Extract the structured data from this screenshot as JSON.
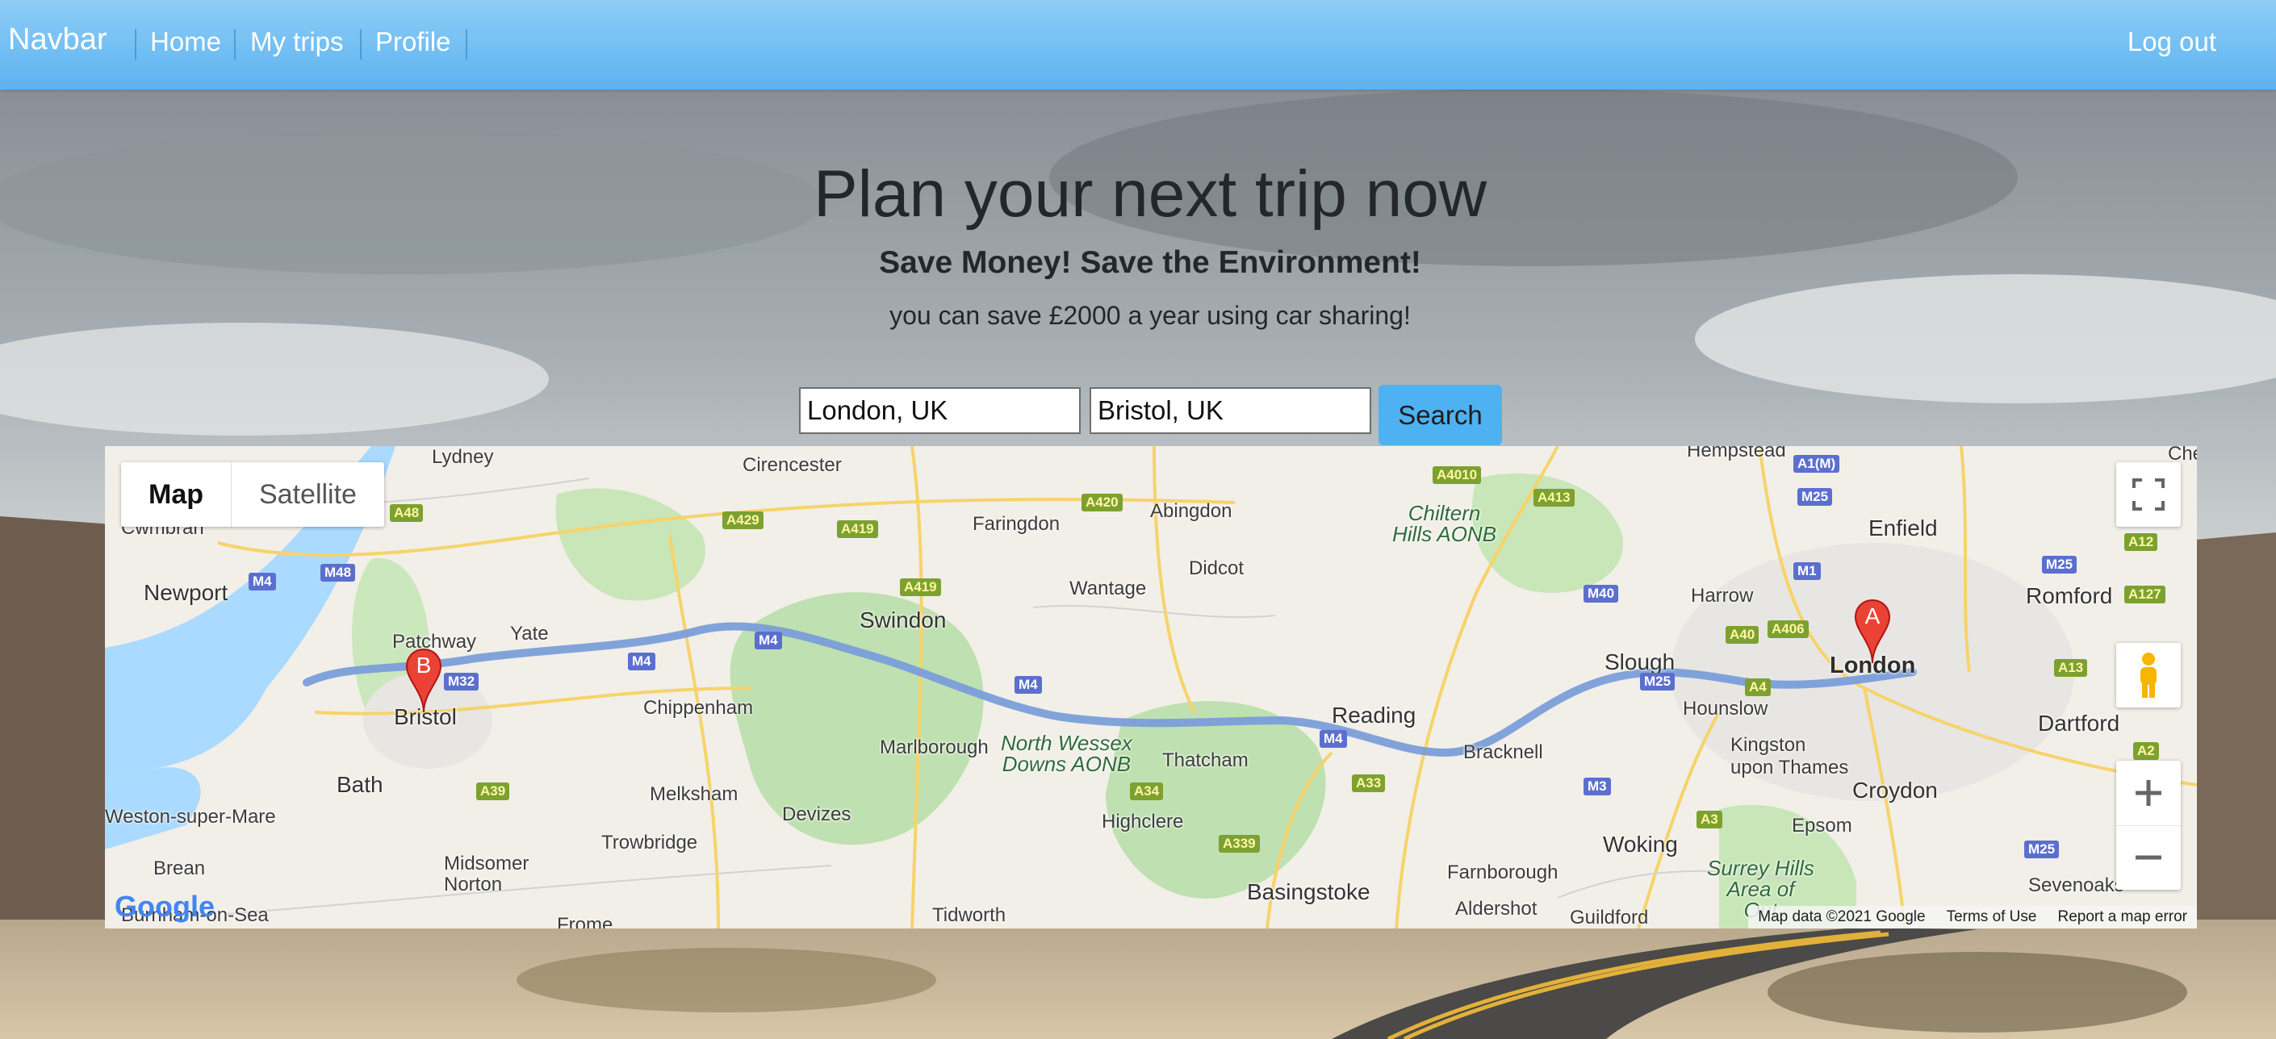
{
  "navbar": {
    "brand": "Navbar",
    "links": [
      "Home",
      "My trips",
      "Profile"
    ],
    "logout": "Log out"
  },
  "hero": {
    "title": "Plan your next trip now",
    "subtitle": "Save Money! Save the Environment!",
    "note": "you can save £2000 a year using car sharing!"
  },
  "search": {
    "origin_value": "London, UK",
    "destination_value": "Bristol, UK",
    "button_label": "Search"
  },
  "map": {
    "type_buttons": [
      "Map",
      "Satellite"
    ],
    "active_type": "Map",
    "markers": [
      "A",
      "B"
    ],
    "logo_text": "Google",
    "attribution": [
      "Map data ©2021 Google",
      "Terms of Use",
      "Report a map error"
    ],
    "places": {
      "lydney": "Lydney",
      "cirencester": "Cirencester",
      "cwmbran": "Cwmbran",
      "newport": "Newport",
      "faringdon": "Faringdon",
      "abingdon": "Abingdon",
      "wantage": "Wantage",
      "didcot": "Didcot",
      "swindon": "Swindon",
      "yate": "Yate",
      "patchway": "Patchway",
      "bristol": "Bristol",
      "chippenham": "Chippenham",
      "bath": "Bath",
      "melksham": "Melksham",
      "devizes": "Devizes",
      "marlborough": "Marlborough",
      "trowbridge": "Trowbridge",
      "weston": "Weston-super-Mare",
      "midsomer": "Midsomer\nNorton",
      "brean": "Brean",
      "burnham": "Burnham-on-Sea",
      "frome": "Frome",
      "tidworth": "Tidworth",
      "thatcham": "Thatcham",
      "highclere": "Highclere",
      "basingstoke": "Basingstoke",
      "reading": "Reading",
      "bracknell": "Bracknell",
      "slough": "Slough",
      "hounslow": "Hounslow",
      "kingston": "Kingston\nupon Thames",
      "croydon": "Croydon",
      "woking": "Woking",
      "epsom": "Epsom",
      "farnborough": "Farnborough",
      "aldershot": "Aldershot",
      "guildford": "Guildford",
      "harrow": "Harrow",
      "enfield": "Enfield",
      "romford": "Romford",
      "dartford": "Dartford",
      "sevenoaks": "Sevenoaks",
      "london": "London",
      "hempstead": "Hempstead",
      "che": "Che",
      "north_wessex": "North Wessex\nDowns AONB",
      "chiltern": "Chiltern\nHills AONB",
      "surrey_hills": "Surrey Hills\nArea of\nOut"
    },
    "shields": {
      "m4a": "M4",
      "m4b": "M4",
      "m4c": "M4",
      "m4d": "M4",
      "m4e": "M4",
      "m48": "M48",
      "m32": "M32",
      "m40": "M40",
      "m1": "M1",
      "m25a": "M25",
      "m25b": "M25",
      "m25c": "M25",
      "m25d": "M25",
      "m3": "M3",
      "a1m": "A1(M)",
      "a48": "A48",
      "a429": "A429",
      "a419a": "A419",
      "a419b": "A419",
      "a420": "A420",
      "a4010": "A4010",
      "a413": "A413",
      "a40": "A40",
      "a406": "A406",
      "a4": "A4",
      "a12": "A12",
      "a127": "A127",
      "a13": "A13",
      "a2": "A2",
      "a39": "A39",
      "a34": "A34",
      "a339": "A339",
      "a33": "A33",
      "a3": "A3"
    }
  }
}
